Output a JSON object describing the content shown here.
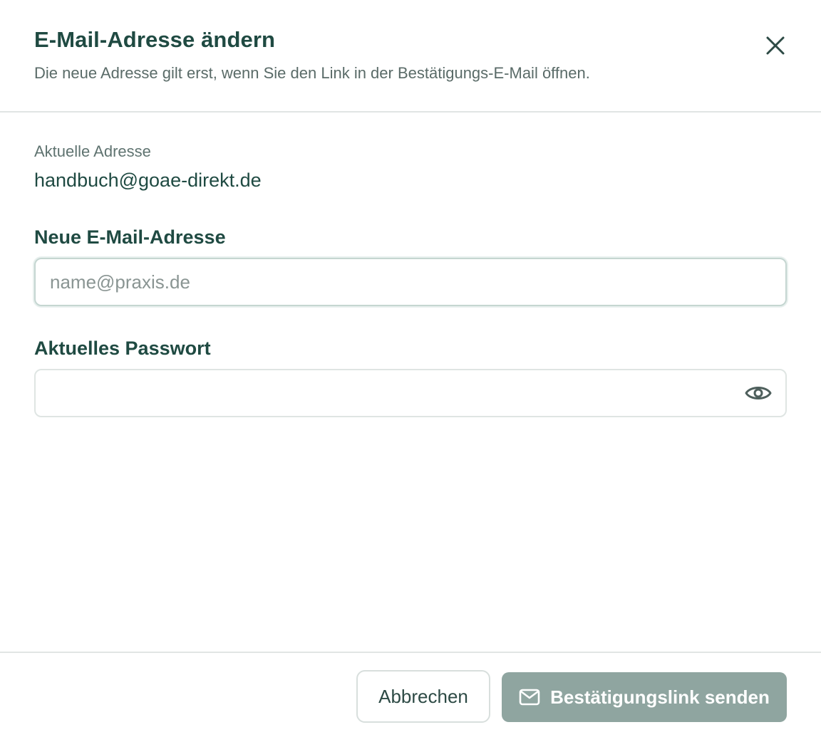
{
  "dialog": {
    "title": "E-Mail-Adresse ändern",
    "subtitle": "Die neue Adresse gilt erst, wenn Sie den Link in der Bestätigungs-E-Mail öffnen.",
    "close_icon": "close-icon"
  },
  "current": {
    "label": "Aktuelle Adresse",
    "value": "handbuch@goae-direkt.de"
  },
  "new_email": {
    "label": "Neue E-Mail-Adresse",
    "value": "",
    "placeholder": "name@praxis.de"
  },
  "password": {
    "label": "Aktuelles Passwort",
    "value": "",
    "toggle_icon": "eye-icon"
  },
  "footer": {
    "cancel_label": "Abbrechen",
    "submit_label": "Bestätigungslink senden",
    "submit_icon": "mail-icon",
    "submit_enabled": false
  },
  "colors": {
    "primary_text": "#1f4a42",
    "muted_text": "#5a6b68",
    "submit_disabled_bg": "#8fa5a0",
    "border": "#dfe5e3"
  }
}
